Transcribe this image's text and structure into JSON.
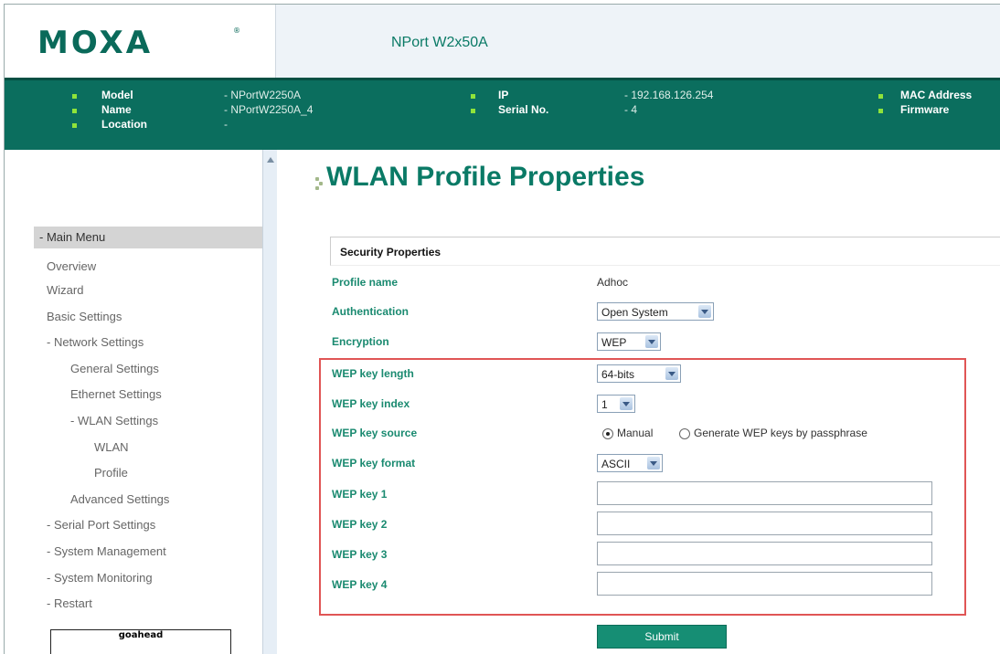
{
  "header": {
    "logo": "MOXA",
    "product_name": "NPort W2x50A"
  },
  "info": {
    "model_label": "Model",
    "model_value": "- NPortW2250A",
    "name_label": "Name",
    "name_value": "- NPortW2250A_4",
    "location_label": "Location",
    "location_value": "-",
    "ip_label": "IP",
    "ip_value": "- 192.168.126.254",
    "serial_label": "Serial No.",
    "serial_value": "- 4",
    "mac_label": "MAC Address",
    "firmware_label": "Firmware"
  },
  "sidebar": {
    "menu_title": "- Main Menu",
    "items": [
      "Overview",
      "Wizard",
      "Basic Settings",
      "- Network Settings",
      "General Settings",
      "Ethernet Settings",
      "- WLAN Settings",
      "WLAN",
      "Profile",
      "Advanced Settings",
      "- Serial Port Settings",
      "- System Management",
      "- System Monitoring",
      "- Restart"
    ],
    "badge": "goahead"
  },
  "main": {
    "page_title": "WLAN Profile Properties",
    "section_title": "Security Properties",
    "profile_name_label": "Profile name",
    "profile_name_value": "Adhoc",
    "authentication_label": "Authentication",
    "authentication_value": "Open System",
    "encryption_label": "Encryption",
    "encryption_value": "WEP",
    "wep_key_length_label": "WEP key length",
    "wep_key_length_value": "64-bits",
    "wep_key_index_label": "WEP key index",
    "wep_key_index_value": "1",
    "wep_key_source_label": "WEP key source",
    "wep_key_source_manual": "Manual",
    "wep_key_source_passphrase": "Generate WEP keys by passphrase",
    "wep_key_format_label": "WEP key format",
    "wep_key_format_value": "ASCII",
    "wep_key1_label": "WEP key 1",
    "wep_key2_label": "WEP key 2",
    "wep_key3_label": "WEP key 3",
    "wep_key4_label": "WEP key 4",
    "submit_label": "Submit"
  },
  "colors": {
    "brand_green": "#0b6e5e",
    "label_green": "#1a8a70",
    "highlight_red": "#e05555",
    "bullet_green": "#8fe33a"
  }
}
